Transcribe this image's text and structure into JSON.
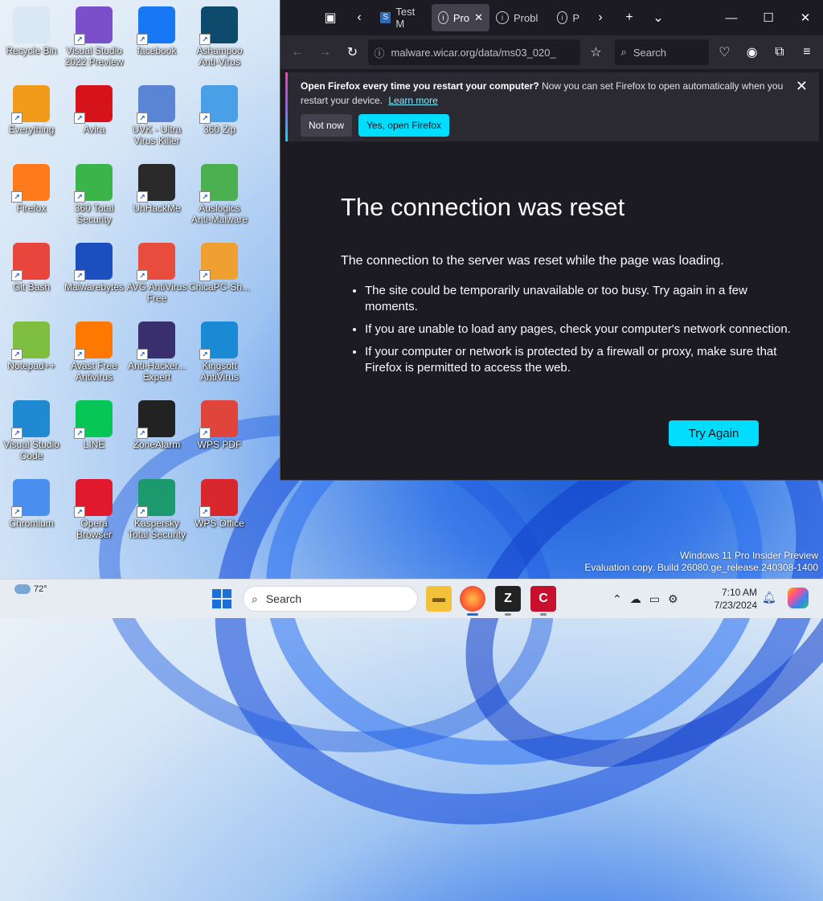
{
  "desktop": {
    "icons": [
      {
        "label": "Recycle Bin",
        "color": "#d9e8f4"
      },
      {
        "label": "Visual Studio 2022 Preview",
        "color": "#7b4fc9"
      },
      {
        "label": "facebook",
        "color": "#1877f2"
      },
      {
        "label": "Ashampoo Anti-Virus",
        "color": "#0d4a6b"
      },
      {
        "label": "Everything",
        "color": "#f29a1a"
      },
      {
        "label": "Avira",
        "color": "#d6131b"
      },
      {
        "label": "UVK - Ultra Virus Killer",
        "color": "#5a84d4"
      },
      {
        "label": "360 Zip",
        "color": "#4aa0e6"
      },
      {
        "label": "Firefox",
        "color": "#ff7a1a"
      },
      {
        "label": "360 Total Security",
        "color": "#3bb54a"
      },
      {
        "label": "UnHackMe",
        "color": "#2a2a2a"
      },
      {
        "label": "Auslogics Anti-Malware",
        "color": "#4caf50"
      },
      {
        "label": "Git Bash",
        "color": "#e8453c"
      },
      {
        "label": "Malwarebytes",
        "color": "#1b4fbf"
      },
      {
        "label": "AVG AntiVirus Free",
        "color": "#e74c3c"
      },
      {
        "label": "ChicaPC-Sh...",
        "color": "#f0a030"
      },
      {
        "label": "Notepad++",
        "color": "#7fbf3f"
      },
      {
        "label": "Avast Free Antivirus",
        "color": "#ff7800"
      },
      {
        "label": "Anti-Hacker... Expert",
        "color": "#3a2f6e"
      },
      {
        "label": "Kingsoft AntiVirus",
        "color": "#1a8ad4"
      },
      {
        "label": "Visual Studio Code",
        "color": "#1f8ad2"
      },
      {
        "label": "LINE",
        "color": "#06c755"
      },
      {
        "label": "ZoneAlarm",
        "color": "#222222"
      },
      {
        "label": "WPS PDF",
        "color": "#e0453c"
      },
      {
        "label": "Chromium",
        "color": "#4a8ff0"
      },
      {
        "label": "Opera Browser",
        "color": "#e0192f"
      },
      {
        "label": "Kaspersky Total Security",
        "color": "#1c9a6e"
      },
      {
        "label": "WPS Office",
        "color": "#d8272d"
      }
    ]
  },
  "browser": {
    "tabs": [
      {
        "label": "Test M",
        "icon": "site-s-icon",
        "active": false
      },
      {
        "label": "Pro",
        "icon": "info-icon",
        "active": true
      },
      {
        "label": "Probl",
        "icon": "info-icon",
        "active": false
      },
      {
        "label": "P",
        "icon": "info-icon",
        "active": false
      }
    ],
    "url": "malware.wicar.org/data/ms03_020_",
    "search_placeholder": "Search",
    "notice": {
      "bold": "Open Firefox every time you restart your computer?",
      "text": "Now you can set Firefox to open automatically when you restart your device.",
      "link": "Learn more",
      "secondary": "Not now",
      "primary": "Yes, open Firefox"
    },
    "error": {
      "title": "The connection was reset",
      "description": "The connection to the server was reset while the page was loading.",
      "items": [
        "The site could be temporarily unavailable or too busy. Try again in a few moments.",
        "If you are unable to load any pages, check your computer's network connection.",
        "If your computer or network is protected by a firewall or proxy, make sure that Firefox is permitted to access the web."
      ],
      "button": "Try Again"
    }
  },
  "watermark": {
    "line1": "Windows 11 Pro Insider Preview",
    "line2": "Evaluation copy. Build 26080.ge_release.240308-1400"
  },
  "taskbar": {
    "weather": "72°",
    "search": "Search",
    "time": "7:10 AM",
    "date": "7/23/2024"
  }
}
